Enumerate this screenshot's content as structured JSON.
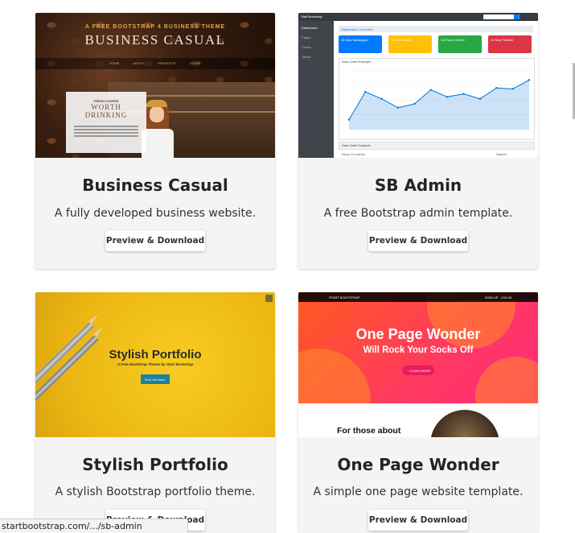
{
  "cards": [
    {
      "title": "Business Casual",
      "description": "A fully developed business website.",
      "button": "Preview & Download",
      "thumbnail": {
        "subtitle": "A FREE BOOTSTRAP 4 BUSINESS THEME",
        "heading": "BUSINESS CASUAL",
        "nav": [
          "HOME",
          "ABOUT",
          "PRODUCTS",
          "STORE"
        ],
        "box_kicker": "FRESH COFFEE",
        "box_heading": "WORTH DRINKING"
      }
    },
    {
      "title": "SB Admin",
      "description": "A free Bootstrap admin template.",
      "button": "Preview & Download",
      "thumbnail": {
        "brand": "Start Bootstrap",
        "sidebar_items": [
          "Dashboard",
          "Pages",
          "Charts",
          "Tables"
        ],
        "breadcrumb": "Dashboard / Overview",
        "tiles": [
          {
            "label": "26 New Messages!",
            "color": "#007bff"
          },
          {
            "label": "11 New Tasks!",
            "color": "#ffc107"
          },
          {
            "label": "123 New Orders!",
            "color": "#28a745"
          },
          {
            "label": "13 New Tickets!",
            "color": "#dc3545"
          }
        ],
        "chart_label": "Area Chart Example",
        "table_label": "Data Table Example",
        "show_label": "Show 10 entries",
        "search_label": "Search:",
        "area_values": [
          10,
          38,
          31,
          22,
          26,
          40,
          33,
          36,
          31,
          42,
          41,
          50
        ]
      }
    },
    {
      "title": "Stylish Portfolio",
      "description": "A stylish Bootstrap portfolio theme.",
      "button": "Preview & Download",
      "thumbnail": {
        "heading": "Stylish Portfolio",
        "tagline": "A Free Bootstrap Theme by Start Bootstrap",
        "button": "Find Out More"
      }
    },
    {
      "title": "One Page Wonder",
      "description": "A simple one page website template.",
      "button": "Preview & Download",
      "thumbnail": {
        "brand": "START BOOTSTRAP",
        "nav": "SIGN UP   LOG IN",
        "heading": "One Page Wonder",
        "subheading": "Will Rock Your Socks Off",
        "button": "LEARN MORE",
        "section_text": "For those about"
      }
    }
  ],
  "status_bar": "startbootstrap.com/.../sb-admin"
}
